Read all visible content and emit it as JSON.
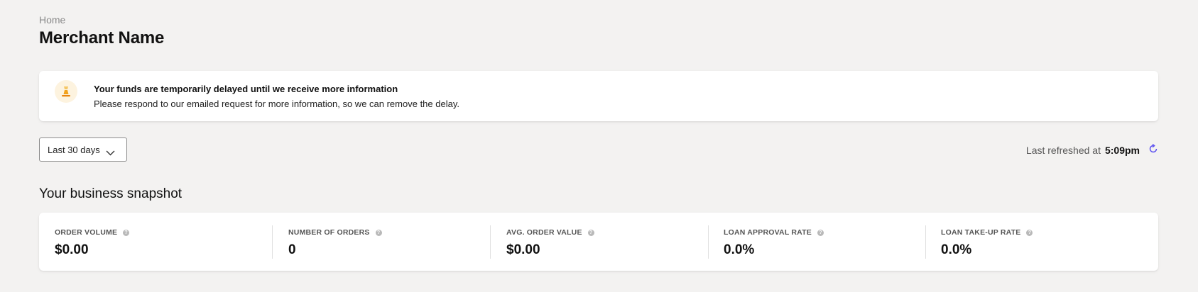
{
  "breadcrumb": "Home",
  "page_title": "Merchant Name",
  "alert": {
    "title": "Your funds are temporarily delayed until we receive more information",
    "body": "Please respond to our emailed request for more information, so we can remove the delay.",
    "icon": "hourglass-icon"
  },
  "date_range": {
    "selected": "Last 30 days"
  },
  "refresh": {
    "label": "Last refreshed at",
    "time": "5:09pm"
  },
  "snapshot": {
    "title": "Your business snapshot",
    "metrics": [
      {
        "label": "ORDER VOLUME",
        "value": "$0.00"
      },
      {
        "label": "NUMBER OF ORDERS",
        "value": "0"
      },
      {
        "label": "AVG. ORDER VALUE",
        "value": "$0.00"
      },
      {
        "label": "LOAN APPROVAL RATE",
        "value": "0.0%"
      },
      {
        "label": "LOAN TAKE-UP RATE",
        "value": "0.0%"
      }
    ]
  },
  "colors": {
    "background": "#f3f2f1",
    "accent": "#5a4ff0",
    "warning": "#f2a21c"
  }
}
